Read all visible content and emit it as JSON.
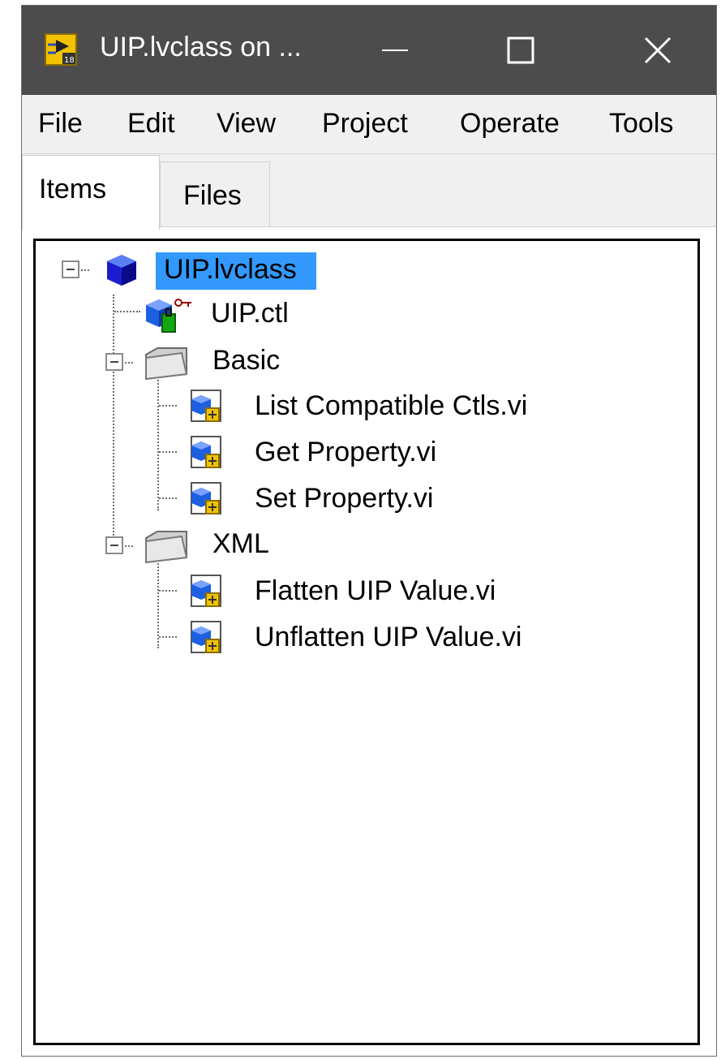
{
  "window": {
    "title": "UIP.lvclass on ...",
    "app_icon": "labview-vi-icon",
    "controls": {
      "minimize": "minimize-icon",
      "maximize": "maximize-icon",
      "close": "close-icon"
    }
  },
  "menu": {
    "items": [
      "File",
      "Edit",
      "View",
      "Project",
      "Operate",
      "Tools"
    ]
  },
  "tabs": {
    "items": "Items",
    "files": "Files",
    "active": "Items"
  },
  "tree": {
    "root": {
      "label": "UIP.lvclass",
      "icon": "lvclass-cube-icon",
      "expanded": true,
      "selected": true
    },
    "ctl": {
      "label": "UIP.ctl",
      "icon": "class-private-data-icon"
    },
    "folders": [
      {
        "label": "Basic",
        "icon": "folder-icon",
        "expanded": true,
        "children": [
          "List Compatible Ctls.vi",
          "Get Property.vi",
          "Set Property.vi"
        ]
      },
      {
        "label": "XML",
        "icon": "folder-icon",
        "expanded": true,
        "children": [
          "Flatten UIP Value.vi",
          "Unflatten UIP Value.vi"
        ]
      }
    ],
    "child_icon": "member-vi-icon"
  },
  "colors": {
    "titlebar": "#4c4c4c",
    "selection": "#3399ff",
    "background": "#f0f0f0"
  }
}
